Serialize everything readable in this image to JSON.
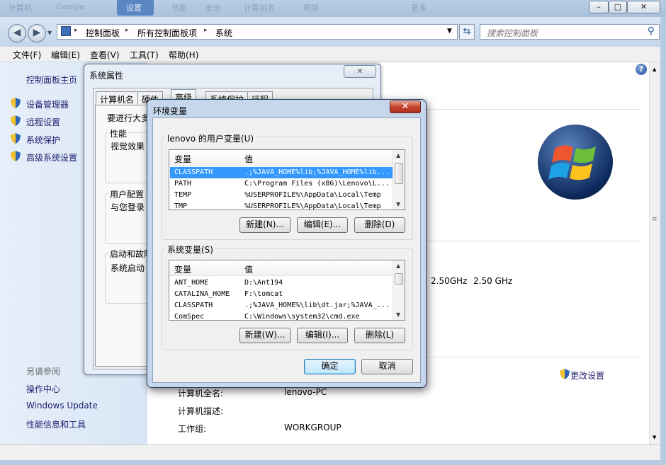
{
  "topstrip": {
    "ghost_texts": [
      "计算机",
      "Google",
      "设置",
      "节能",
      "安全",
      "计算机名",
      "帮助",
      "更多"
    ],
    "caption_min": "–",
    "caption_max": "□",
    "caption_close": "✕"
  },
  "nav": {
    "back_icon": "back-arrow-icon",
    "forward_icon": "forward-arrow-icon",
    "breadcrumb": [
      "控制面板",
      "所有控制面板项",
      "系统"
    ],
    "sep": "▸",
    "search_placeholder": "搜索控制面板"
  },
  "menu": [
    "文件(F)",
    "编辑(E)",
    "查看(V)",
    "工具(T)",
    "帮助(H)"
  ],
  "left_pane": {
    "home": "控制面板主页",
    "items": [
      "设备管理器",
      "远程设置",
      "系统保护",
      "高级系统设置"
    ],
    "see_also": "另请参阅",
    "see_also_items": [
      "操作中心",
      "Windows Update",
      "性能信息和工具"
    ]
  },
  "right_pane": {
    "cpu_speed_1": "2.50GHz",
    "cpu_speed_2": "2.50 GHz",
    "change_settings": "更改设置",
    "rows": [
      {
        "label": "计算机全名:",
        "value": "lenovo-PC"
      },
      {
        "label": "计算机描述:",
        "value": ""
      },
      {
        "label": "工作组:",
        "value": "WORKGROUP"
      }
    ]
  },
  "sysprop": {
    "title": "系统属性",
    "tabs": [
      "计算机名",
      "硬件",
      "高级",
      "系统保护",
      "远程"
    ],
    "admin_note": "要进行大多",
    "groups": [
      {
        "title": "性能",
        "text": "视觉效果"
      },
      {
        "title": "用户配置",
        "text": "与您登录"
      },
      {
        "title": "启动和故障",
        "text": "系统启动"
      }
    ]
  },
  "env": {
    "title": "环境变量",
    "close": "✕",
    "user_group_title": "lenovo 的用户变量(U)",
    "sys_group_title": "系统变量(S)",
    "col_var": "变量",
    "col_val": "值",
    "user_vars": [
      {
        "name": "CLASSPATH",
        "value": ".;%JAVA_HOME%lib;%JAVA_HOME%lib...",
        "selected": true
      },
      {
        "name": "PATH",
        "value": "C:\\Program Files (x86)\\Lenovo\\L...",
        "selected": false
      },
      {
        "name": "TEMP",
        "value": "%USERPROFILE%\\AppData\\Local\\Temp",
        "selected": false
      },
      {
        "name": "TMP",
        "value": "%USERPROFILE%\\AppData\\Local\\Temp",
        "selected": false
      }
    ],
    "sys_vars": [
      {
        "name": "ANT_HOME",
        "value": "D:\\Ant194"
      },
      {
        "name": "CATALINA_HOME",
        "value": "F:\\tomcat"
      },
      {
        "name": "CLASSPATH",
        "value": ".;%JAVA_HOME%\\lib\\dt.jar;%JAVA_..."
      },
      {
        "name": "ComSpec",
        "value": "C:\\Windows\\system32\\cmd.exe"
      }
    ],
    "user_buttons": [
      "新建(N)...",
      "编辑(E)...",
      "删除(D)"
    ],
    "sys_buttons": [
      "新建(W)...",
      "编辑(I)...",
      "删除(L)"
    ],
    "ok": "确定",
    "cancel": "取消"
  },
  "colors": {
    "selection": "#3399ff",
    "link": "#1e1e6e",
    "close_red": "#c4442b"
  }
}
